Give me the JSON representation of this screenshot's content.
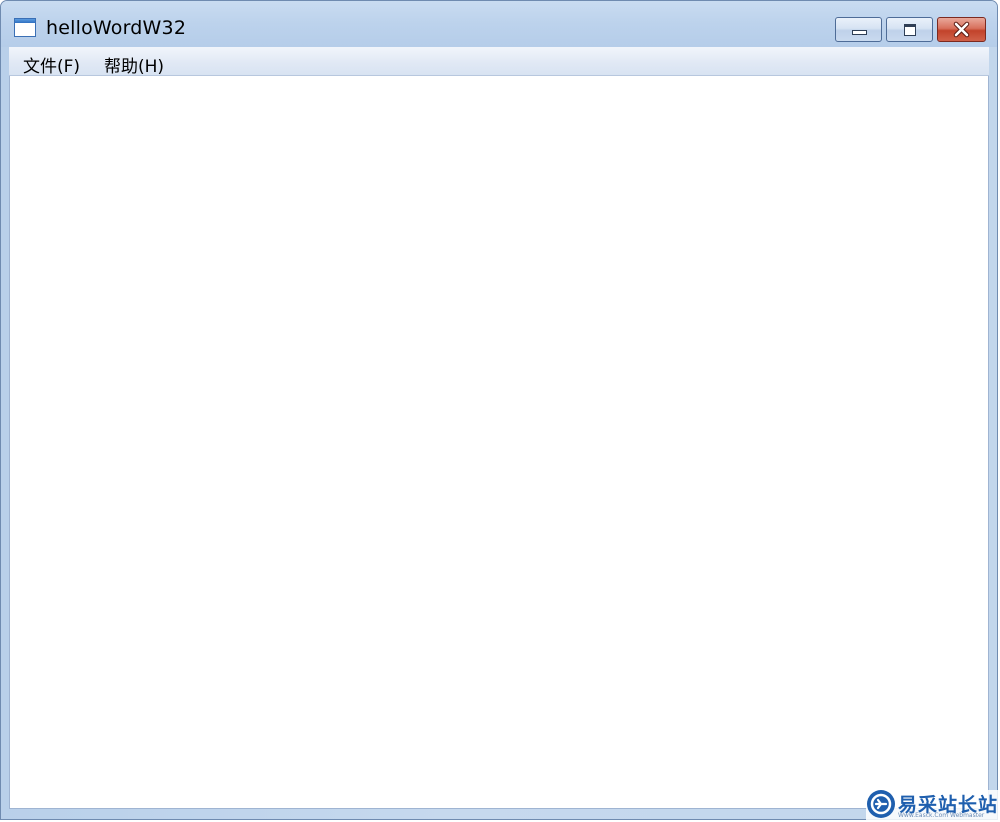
{
  "window": {
    "title": "helloWordW32",
    "icon": "window-app-icon"
  },
  "caption_buttons": {
    "minimize_icon": "minimize-icon",
    "maximize_icon": "maximize-icon",
    "close_icon": "close-icon"
  },
  "menu": {
    "items": [
      {
        "label": "文件(F)"
      },
      {
        "label": "帮助(H)"
      }
    ]
  },
  "watermark": {
    "icon": "site-logo-icon",
    "text": "易采站长站",
    "subtext": "Www.Easck.Com Webmaster"
  },
  "colors": {
    "titlebar": "#bcd2ec",
    "close_button": "#c2432b",
    "watermark": "#1f5fae"
  }
}
